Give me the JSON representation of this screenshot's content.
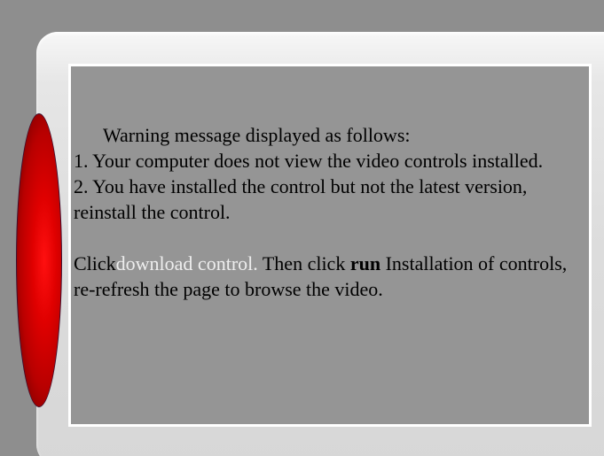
{
  "message": {
    "heading": "Warning message displayed as follows:",
    "item1": "1. Your computer does not view the video controls installed.",
    "item2": "2. You have installed the control but not the latest version, reinstall the control.",
    "instruction_prefix": "Click",
    "download_link": "download control.",
    "instruction_middle": " Then click ",
    "run_word": "run",
    "instruction_suffix": " Installation of controls, re-refresh the page to browse the video."
  },
  "colors": {
    "background": "#8e8e8e",
    "panel": "#959595",
    "link": "#eeeeee",
    "lens": "#e00000"
  }
}
